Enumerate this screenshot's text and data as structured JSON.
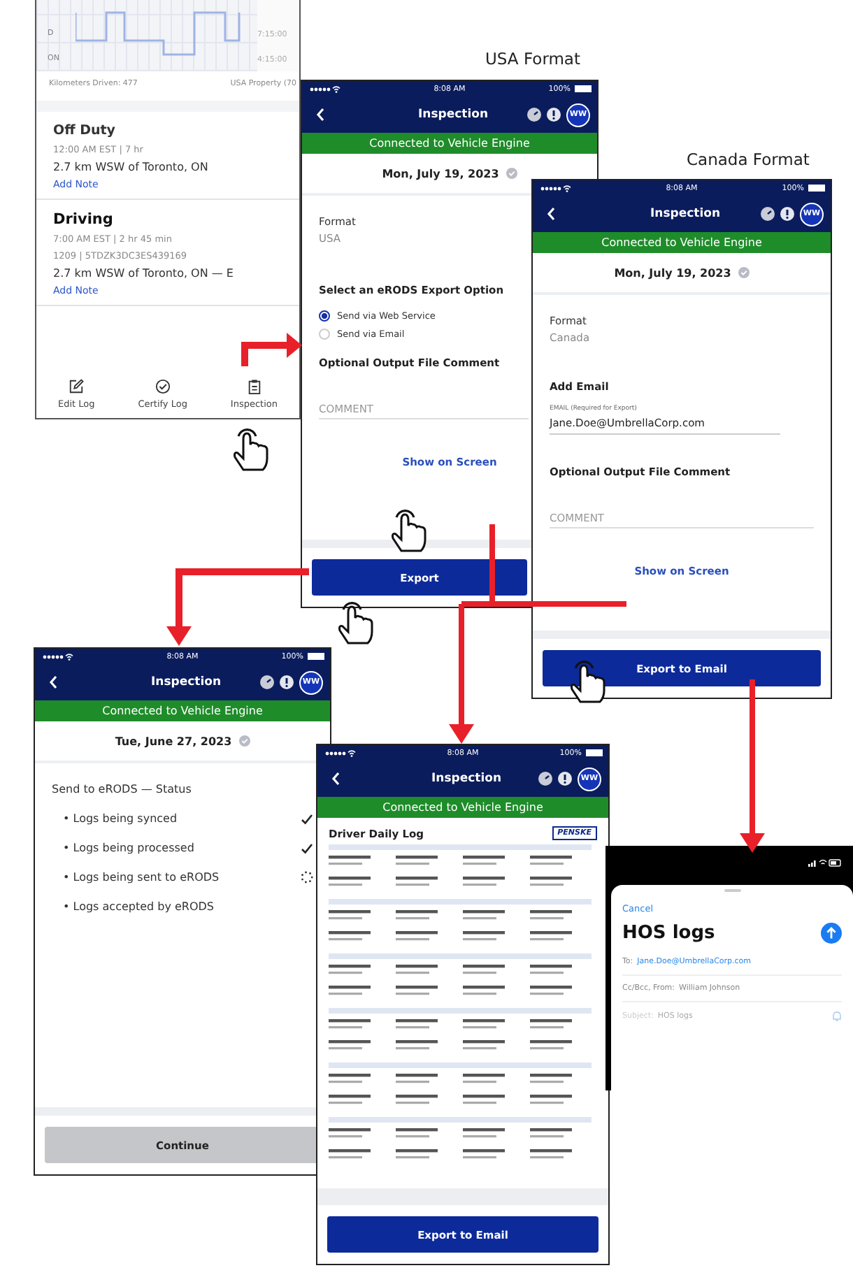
{
  "log_screen": {
    "chart_row_labels": [
      "D",
      "ON"
    ],
    "chart_times": [
      "7:15:00",
      "4:15:00"
    ],
    "kilometers": "Kilometers Driven: 477",
    "property": "USA Property (70",
    "entries": [
      {
        "status": "Off Duty",
        "lines": [
          "12:00 AM EST | 7 hr"
        ],
        "location": "2.7 km WSW of Toronto, ON",
        "note_link": "Add Note"
      },
      {
        "status": "Driving",
        "lines": [
          "7:00 AM EST | 2 hr 45 min",
          "1209 | 5TDZK3DC3ES439169"
        ],
        "location": "2.7 km WSW of Toronto, ON — E",
        "note_link": "Add Note"
      }
    ],
    "toolbar": [
      {
        "kind": "edit",
        "label": "Edit Log"
      },
      {
        "kind": "certify",
        "label": "Certify Log"
      },
      {
        "kind": "inspection",
        "label": "Inspection"
      }
    ]
  },
  "captions": [
    "USA Format",
    "Canada Format"
  ],
  "screens": [
    {
      "kind": "usa_export",
      "time": "8:08 AM",
      "battery": "100%",
      "title": "Inspection",
      "avatar": "WW",
      "banner": "Connected to Vehicle Engine",
      "date": "Mon, July 19, 2023",
      "format_label": "Format",
      "format_value": "USA",
      "options_heading": "Select an eRODS Export Option",
      "options": [
        {
          "label": "Send via Web Service",
          "selected": true
        },
        {
          "label": "Send via Email",
          "selected": false
        }
      ],
      "comment_heading": "Optional Output File Comment",
      "comment_placeholder": "COMMENT",
      "link": "Show on Screen",
      "button": {
        "label": "Export",
        "disabled": false
      }
    },
    {
      "kind": "canada_export",
      "time": "8:08 AM",
      "battery": "100%",
      "title": "Inspection",
      "avatar": "WW",
      "banner": "Connected to Vehicle Engine",
      "date": "Mon, July 19, 2023",
      "format_label": "Format",
      "format_value": "Canada",
      "email_heading": "Add Email",
      "email_label": "EMAIL (Required for Export)",
      "email_value": "Jane.Doe@UmbrellaCorp.com",
      "comment_heading": "Optional Output File Comment",
      "comment_placeholder": "COMMENT",
      "link": "Show on Screen",
      "button": {
        "label": "Export to Email",
        "disabled": false
      }
    },
    {
      "kind": "erods_status",
      "time": "8:08 AM",
      "battery": "100%",
      "title": "Inspection",
      "avatar": "WW",
      "banner": "Connected to Vehicle Engine",
      "date": "Tue, June 27, 2023",
      "heading": "Send to eRODS — Status",
      "items": [
        {
          "label": "• Logs being synced",
          "done": true,
          "loading": false
        },
        {
          "label": "• Logs being processed",
          "done": true,
          "loading": false
        },
        {
          "label": "• Logs being sent to eRODS",
          "done": false,
          "loading": true
        },
        {
          "label": "• Logs accepted by eRODS",
          "done": false,
          "loading": false
        }
      ],
      "button": {
        "label": "Continue",
        "disabled": true
      }
    },
    {
      "kind": "report_preview",
      "time": "8:08 AM",
      "battery": "100%",
      "title": "Inspection",
      "avatar": "WW",
      "banner": "Connected to Vehicle Engine",
      "doc_title": "Driver Daily Log",
      "doc_logo": "PENSKE",
      "button": {
        "label": "Export to Email",
        "disabled": false
      }
    }
  ],
  "email_sheet": {
    "cancel": "Cancel",
    "title": "HOS logs",
    "to_label": "To:",
    "to_value": "Jane.Doe@UmbrellaCorp.com",
    "cc_label": "Cc/Bcc, From:",
    "cc_value": "William Johnson",
    "subject_label": "Subject:",
    "subject_value": "HOS logs"
  }
}
